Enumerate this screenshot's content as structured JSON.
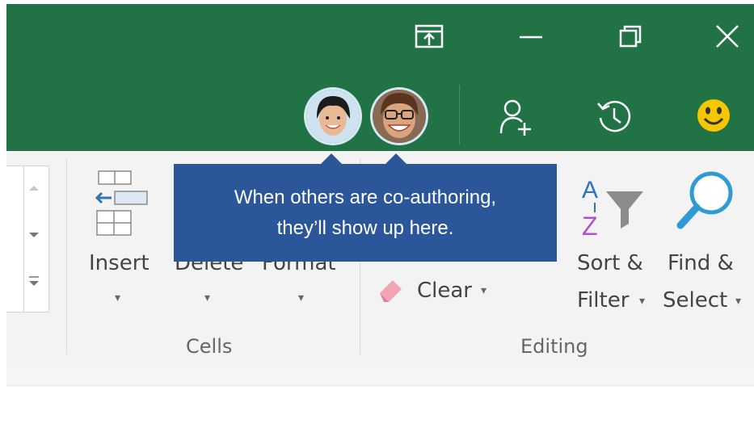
{
  "colors": {
    "titlebar": "#217346",
    "callout": "#2b579a",
    "ribbon": "#f3f3f3"
  },
  "window_controls": [
    {
      "name": "ribbon-display-options-icon"
    },
    {
      "name": "minimize-icon"
    },
    {
      "name": "restore-icon"
    },
    {
      "name": "close-icon"
    }
  ],
  "coauthor_icons": [
    "share-icon",
    "activity-history-icon",
    "smiley-feedback-icon"
  ],
  "callout": {
    "line1": "When others are co-authoring,",
    "line2": "they’ll show up here."
  },
  "cells_group": {
    "insert_label": "Insert",
    "delete_label": "Delete",
    "format_label": "Format",
    "group_label": "Cells"
  },
  "editing_group": {
    "clear_label": "Clear",
    "sort_label_1": "Sort &",
    "sort_label_2": "Filter",
    "find_label_1": "Find &",
    "find_label_2": "Select",
    "group_label": "Editing"
  },
  "dropdown_glyph": "▾"
}
